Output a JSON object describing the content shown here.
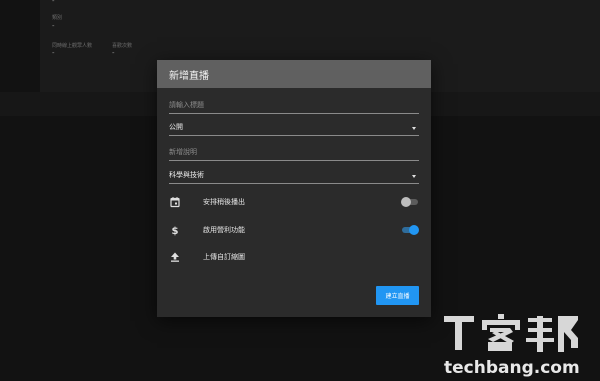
{
  "background": {
    "field_label": "類別",
    "field_value": "-",
    "stat1_label": "同時線上觀眾人數",
    "stat1_value": "-",
    "stat2_label": "喜歡次數",
    "stat2_value": "-"
  },
  "dialog": {
    "title": "新增直播",
    "title_placeholder": "請輸入標題",
    "privacy_value": "公開",
    "description_placeholder": "新增說明",
    "category_value": "科學與技術",
    "schedule_label": "安排稍後播出",
    "schedule_enabled": false,
    "monetize_label": "啟用營利功能",
    "monetize_enabled": true,
    "upload_thumbnail_label": "上傳自訂縮圖",
    "create_button_label": "建立直播"
  },
  "watermark": {
    "logo_text": "T客邦",
    "site": "techbang.com"
  },
  "colors": {
    "accent": "#2196f3",
    "dialog_bg": "#2b2b2b",
    "header_bg": "#606060"
  },
  "icons": [
    "calendar-icon",
    "dollar-icon",
    "upload-icon"
  ]
}
